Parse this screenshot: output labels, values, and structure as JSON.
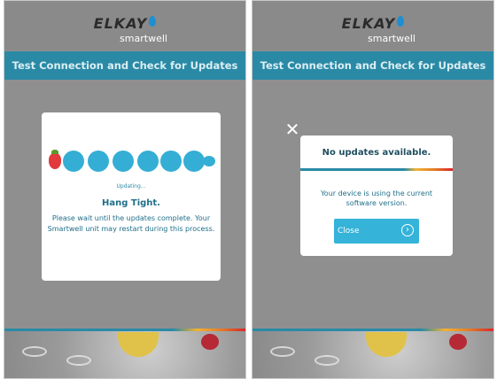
{
  "brand": {
    "name": "ELKAY",
    "product": "smartwell",
    "colors": {
      "header_bar": "#2a8aa6",
      "accent": "#35b3d8"
    }
  },
  "screen_left": {
    "title": "Test Connection and Check for Updates",
    "dialog": {
      "status_text": "Updating...",
      "heading": "Hang Tight.",
      "message": "Please wait until the updates complete. Your Smartwell unit may restart during this process."
    }
  },
  "screen_right": {
    "title": "Test Connection and Check for Updates",
    "dialog": {
      "heading": "No updates available.",
      "message": "Your device is using the current software version.",
      "close_button_label": "Close",
      "close_icon": "close-x-icon",
      "arrow_icon": "chevron-right-circle-icon"
    }
  }
}
